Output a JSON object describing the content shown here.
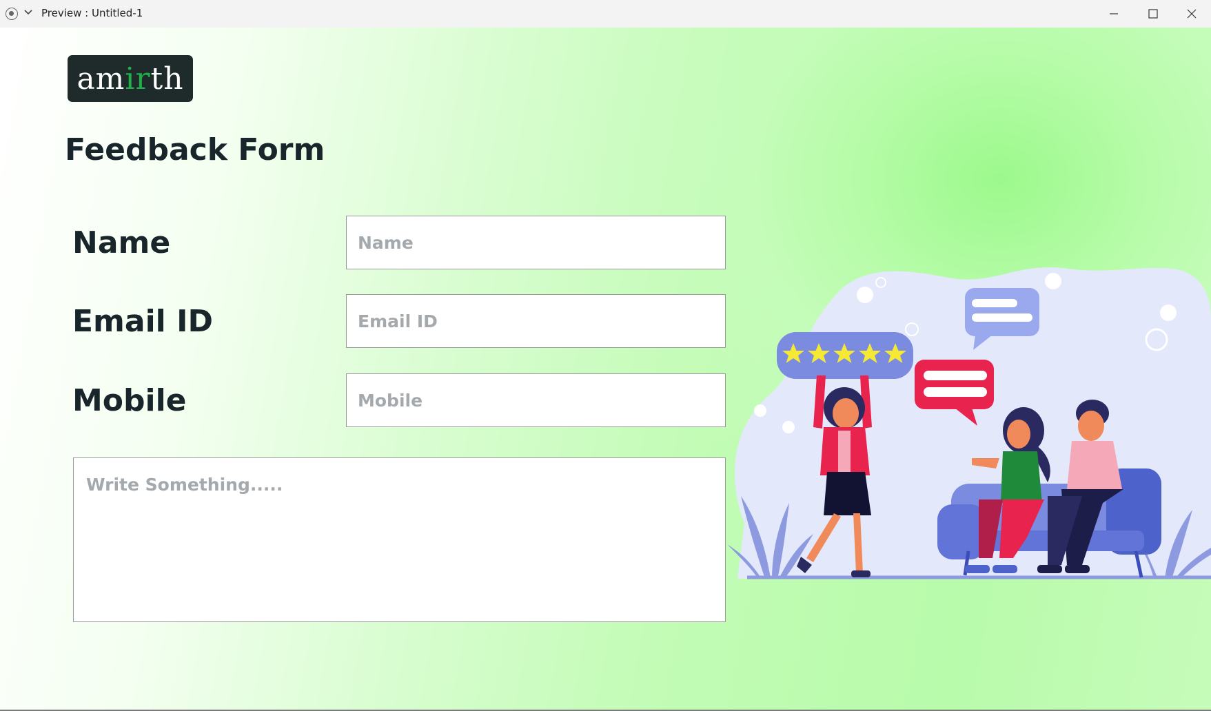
{
  "window": {
    "title": "Preview : Untitled-1"
  },
  "brand": {
    "logo_prefix": "am",
    "logo_accent": "ir",
    "logo_suffix": "th",
    "logo_text": "amirth",
    "accent_color": "#20b04a",
    "logo_bg": "#1e2b2a"
  },
  "form": {
    "title": "Feedback Form",
    "fields": [
      {
        "label": "Name",
        "placeholder": "Name",
        "value": ""
      },
      {
        "label": "Email ID",
        "placeholder": "Email ID",
        "value": ""
      },
      {
        "label": "Mobile",
        "placeholder": "Mobile",
        "value": ""
      }
    ],
    "message": {
      "placeholder": "Write Something.....",
      "value": ""
    }
  },
  "illustration": {
    "rating_stars": 5,
    "star_color": "#f5e935",
    "blob_color": "#e3e8fb"
  },
  "colors": {
    "background_green": "#b7fca9",
    "text_dark": "#18252a"
  }
}
